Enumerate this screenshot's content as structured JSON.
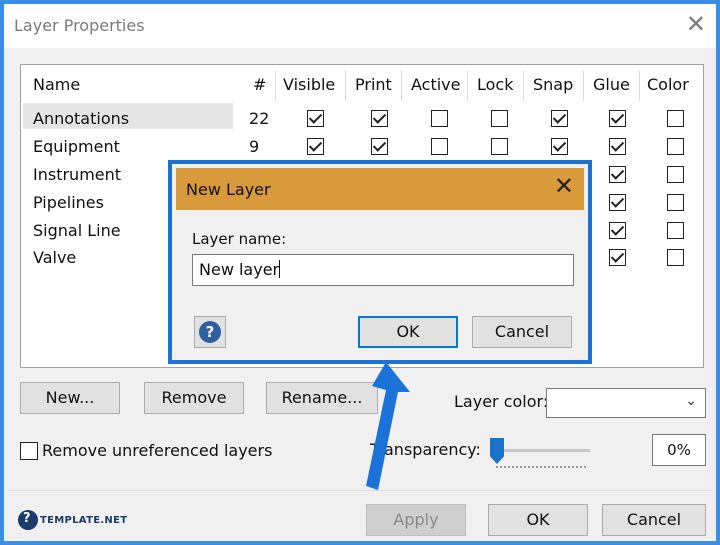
{
  "window": {
    "title": "Layer Properties",
    "close_glyph": "✕"
  },
  "table": {
    "headers": {
      "name": "Name",
      "num": "#",
      "visible": "Visible",
      "print": "Print",
      "active": "Active",
      "lock": "Lock",
      "snap": "Snap",
      "glue": "Glue",
      "color": "Color"
    },
    "rows": [
      {
        "name": "Annotations",
        "num": "22",
        "visible": true,
        "print": true,
        "active": false,
        "lock": false,
        "snap": true,
        "glue": true,
        "color": false
      },
      {
        "name": "Equipment",
        "num": "9",
        "visible": true,
        "print": true,
        "active": false,
        "lock": false,
        "snap": true,
        "glue": true,
        "color": false
      },
      {
        "name": "Instrument",
        "glue": true,
        "color": false
      },
      {
        "name": "Pipelines",
        "glue": true,
        "color": false
      },
      {
        "name": "Signal Line",
        "glue": true,
        "color": false
      },
      {
        "name": "Valve",
        "glue": true,
        "color": false
      }
    ]
  },
  "buttons": {
    "new": "New...",
    "remove": "Remove",
    "rename": "Rename...",
    "apply": "Apply",
    "ok": "OK",
    "cancel": "Cancel"
  },
  "layer_color_label": "Layer color:",
  "layer_color_value": "",
  "remove_unreferenced": {
    "label": "Remove unreferenced layers",
    "checked": false
  },
  "transparency": {
    "label": "Transparency:",
    "value": "0%",
    "level": 0
  },
  "dialog": {
    "title": "New Layer",
    "close_glyph": "✕",
    "field_label": "Layer name:",
    "field_value": "New layer",
    "help_glyph": "?",
    "ok": "OK",
    "cancel": "Cancel"
  },
  "watermark": "TEMPLATE.NET",
  "colors": {
    "accent": "#1b72d8",
    "dialog_title": "#d99a3c",
    "arrow": "#1b72d8"
  }
}
